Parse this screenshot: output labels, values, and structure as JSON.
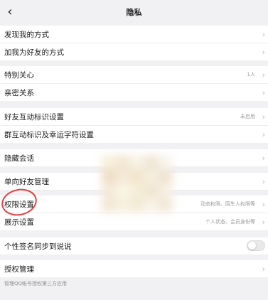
{
  "header": {
    "title": "隐私",
    "back_icon": "chevron-left-icon"
  },
  "items": [
    {
      "label": "发现我的方式",
      "value": "",
      "chevron": "›"
    },
    {
      "label": "加我为好友的方式",
      "value": "",
      "chevron": "›"
    },
    {
      "label": "特别关心",
      "value": "1人",
      "chevron": "›"
    },
    {
      "label": "亲密关系",
      "value": "",
      "chevron": "›"
    },
    {
      "label": "好友互动标识设置",
      "value": "未启用",
      "chevron": "›"
    },
    {
      "label": "群互动标识及幸运字符设置",
      "value": "",
      "chevron": "›"
    },
    {
      "label": "隐藏会话",
      "value": "",
      "chevron": "›"
    },
    {
      "label": "单向好友管理",
      "value": "",
      "chevron": "›"
    },
    {
      "label": "权限设置",
      "value": "动态权限、陌生人权限等",
      "chevron": "›"
    },
    {
      "label": "展示设置",
      "value": "个人状态、会员身份等",
      "chevron": "›"
    },
    {
      "label": "个性签名同步到说说",
      "toggle": false
    },
    {
      "label": "授权管理",
      "value": "",
      "chevron": "›"
    }
  ],
  "footer": {
    "text": "管理QQ帐号授权第三方应用"
  },
  "colors": {
    "background": "#f1f1f4",
    "card": "#ffffff",
    "annotation_red": "#e34143"
  }
}
